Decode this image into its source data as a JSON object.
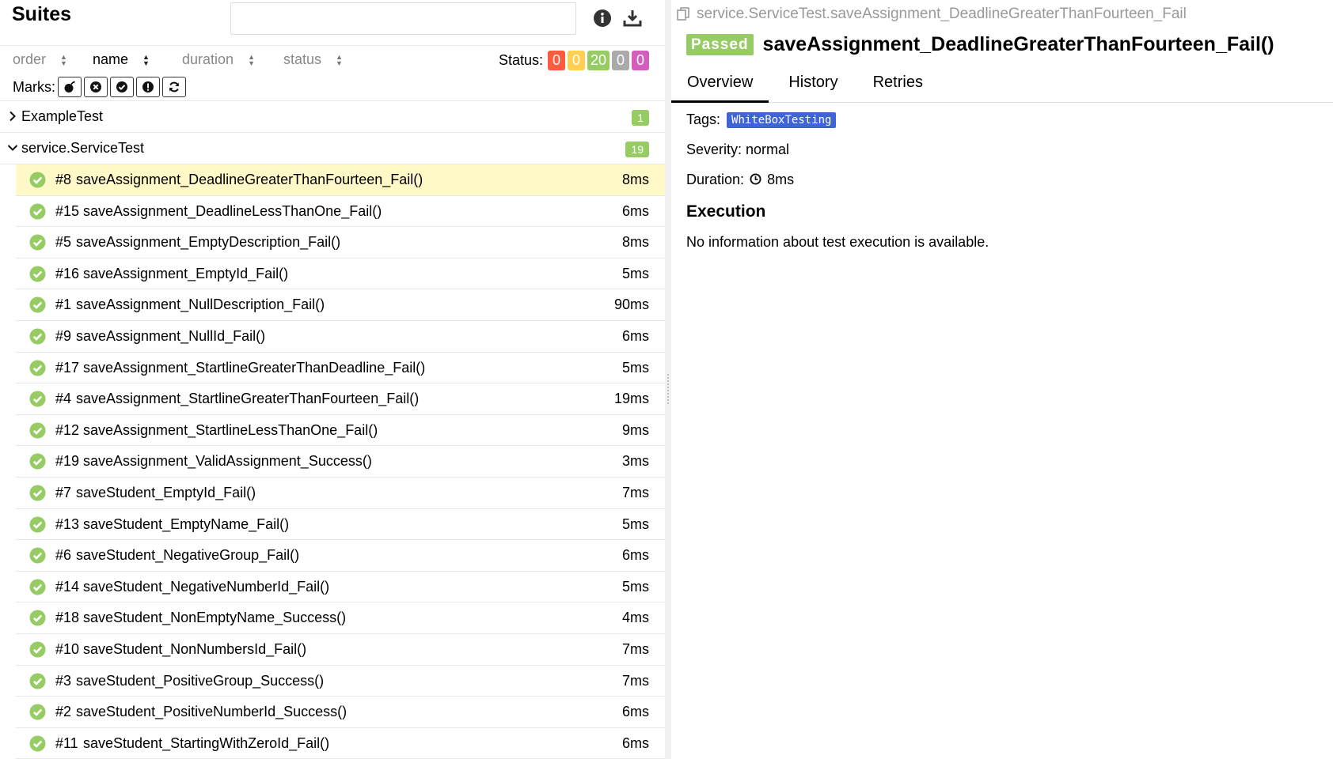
{
  "left": {
    "title": "Suites",
    "search": {
      "placeholder": ""
    },
    "sort": {
      "order": "order",
      "name": "name",
      "duration": "duration",
      "status": "status"
    },
    "status": {
      "label": "Status:",
      "failed": "0",
      "broken": "0",
      "passed": "20",
      "skipped": "0",
      "unknown": "0"
    },
    "marks_label": "Marks:",
    "groups": [
      {
        "name": "ExampleTest",
        "count": "1"
      },
      {
        "name": "service.ServiceTest",
        "count": "19"
      }
    ],
    "tests": [
      {
        "num": "#8",
        "name": "saveAssignment_DeadlineGreaterThanFourteen_Fail()",
        "duration": "8ms"
      },
      {
        "num": "#15",
        "name": "saveAssignment_DeadlineLessThanOne_Fail()",
        "duration": "6ms"
      },
      {
        "num": "#5",
        "name": "saveAssignment_EmptyDescription_Fail()",
        "duration": "8ms"
      },
      {
        "num": "#16",
        "name": "saveAssignment_EmptyId_Fail()",
        "duration": "5ms"
      },
      {
        "num": "#1",
        "name": "saveAssignment_NullDescription_Fail()",
        "duration": "90ms"
      },
      {
        "num": "#9",
        "name": "saveAssignment_NullId_Fail()",
        "duration": "6ms"
      },
      {
        "num": "#17",
        "name": "saveAssignment_StartlineGreaterThanDeadline_Fail()",
        "duration": "5ms"
      },
      {
        "num": "#4",
        "name": "saveAssignment_StartlineGreaterThanFourteen_Fail()",
        "duration": "19ms"
      },
      {
        "num": "#12",
        "name": "saveAssignment_StartlineLessThanOne_Fail()",
        "duration": "9ms"
      },
      {
        "num": "#19",
        "name": "saveAssignment_ValidAssignment_Success()",
        "duration": "3ms"
      },
      {
        "num": "#7",
        "name": "saveStudent_EmptyId_Fail()",
        "duration": "7ms"
      },
      {
        "num": "#13",
        "name": "saveStudent_EmptyName_Fail()",
        "duration": "5ms"
      },
      {
        "num": "#6",
        "name": "saveStudent_NegativeGroup_Fail()",
        "duration": "6ms"
      },
      {
        "num": "#14",
        "name": "saveStudent_NegativeNumberId_Fail()",
        "duration": "5ms"
      },
      {
        "num": "#18",
        "name": "saveStudent_NonEmptyName_Success()",
        "duration": "4ms"
      },
      {
        "num": "#10",
        "name": "saveStudent_NonNumbersId_Fail()",
        "duration": "7ms"
      },
      {
        "num": "#3",
        "name": "saveStudent_PositiveGroup_Success()",
        "duration": "7ms"
      },
      {
        "num": "#2",
        "name": "saveStudent_PositiveNumberId_Success()",
        "duration": "6ms"
      },
      {
        "num": "#11",
        "name": "saveStudent_StartingWithZeroId_Fail()",
        "duration": "6ms"
      }
    ]
  },
  "right": {
    "breadcrumb": "service.ServiceTest.saveAssignment_DeadlineGreaterThanFourteen_Fail",
    "status_badge": "Passed",
    "title": "saveAssignment_DeadlineGreaterThanFourteen_Fail()",
    "tabs": [
      "Overview",
      "History",
      "Retries"
    ],
    "tags_label": "Tags:",
    "tag": "WhiteBoxTesting",
    "severity": "Severity: normal",
    "duration_label": "Duration:",
    "duration_value": "8ms",
    "execution_title": "Execution",
    "execution_text": "No information about test execution is available."
  },
  "colors": {
    "failed": "#fd5a3e",
    "broken": "#ffd050",
    "passed": "#97cc64",
    "skipped": "#aaaaaa",
    "unknown": "#d35ebe",
    "selected_row": "#fff8c7",
    "tag": "#3e64d6"
  }
}
